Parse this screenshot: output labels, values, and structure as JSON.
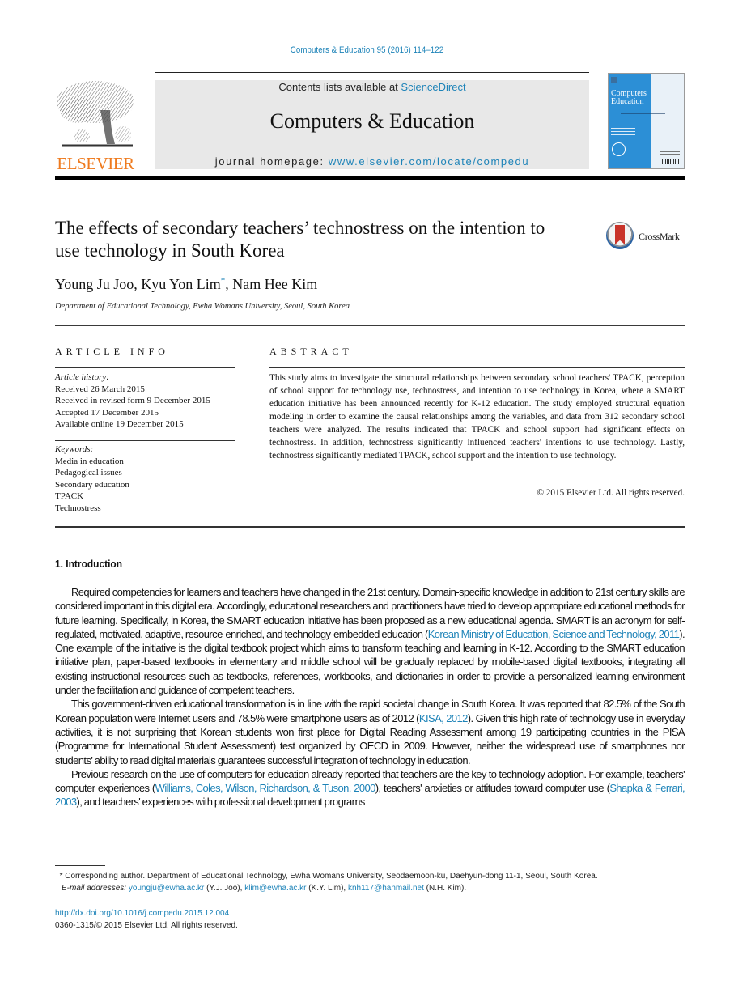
{
  "header": {
    "citation": "Computers & Education 95 (2016) 114–122",
    "publisher_logo_text": "ELSEVIER",
    "contents_prefix": "Contents lists available at ",
    "contents_link": "ScienceDirect",
    "journal_name": "Computers & Education",
    "homepage_prefix": "journal homepage: ",
    "homepage_link": "www.elsevier.com/locate/compedu",
    "cover_title_line1": "Computers",
    "cover_title_line2": "Education"
  },
  "article": {
    "title": "The effects of secondary teachers’ technostress on the intention to use technology in South Korea",
    "crossmark_label": "CrossMark",
    "authors": {
      "a1": "Young Ju Joo, ",
      "a2": "Kyu Yon Lim",
      "a2_mark": "*",
      "a3": ", Nam Hee Kim"
    },
    "affiliation": "Department of Educational Technology, Ewha Womans University, Seoul, South Korea"
  },
  "article_info": {
    "heading": "ARTICLE INFO",
    "history_label": "Article history:",
    "history": [
      "Received 26 March 2015",
      "Received in revised form 9 December 2015",
      "Accepted 17 December 2015",
      "Available online 19 December 2015"
    ],
    "keywords_label": "Keywords:",
    "keywords": [
      "Media in education",
      "Pedagogical issues",
      "Secondary education",
      "TPACK",
      "Technostress"
    ]
  },
  "abstract": {
    "heading": "ABSTRACT",
    "text": "This study aims to investigate the structural relationships between secondary school teachers' TPACK, perception of school support for technology use, technostress, and intention to use technology in Korea, where a SMART education initiative has been announced recently for K-12 education. The study employed structural equation modeling in order to examine the causal relationships among the variables, and data from 312 secondary school teachers were analyzed. The results indicated that TPACK and school support had significant effects on technostress. In addition, technostress significantly influenced teachers' intentions to use technology. Lastly, technostress significantly mediated TPACK, school support and the intention to use technology.",
    "copyright": "© 2015 Elsevier Ltd. All rights reserved."
  },
  "introduction": {
    "heading": "1.  Introduction",
    "p1_a": "Required competencies for learners and teachers have changed in the 21st century. Domain-specific knowledge in addition to 21st century skills are considered important in this digital era. Accordingly, educational researchers and practitioners have tried to develop appropriate educational methods for future learning. Specifically, in Korea, the SMART education initiative has been proposed as a new educational agenda. SMART is an acronym for self-regulated, motivated, adaptive, resource-enriched, and technology-embedded education (",
    "p1_ref": "Korean Ministry of Education, Science and Technology, 2011",
    "p1_b": "). One example of the initiative is the digital textbook project which aims to transform teaching and learning in K-12. According to the SMART education initiative plan, paper-based textbooks in elementary and middle school will be gradually replaced by mobile-based digital textbooks, integrating all existing instructional resources such as textbooks, references, workbooks, and dictionaries in order to provide a personalized learning environment under the facilitation and guidance of competent teachers.",
    "p2_a": "This government-driven educational transformation is in line with the rapid societal change in South Korea. It was reported that 82.5% of the South Korean population were Internet users and 78.5% were smartphone users as of 2012 (",
    "p2_ref": "KISA, 2012",
    "p2_b": "). Given this high rate of technology use in everyday activities, it is not surprising that Korean students won first place for Digital Reading Assessment among 19 participating countries in the PISA (Programme for International Student Assessment) test organized by OECD in 2009. However, neither the widespread use of smartphones nor students' ability to read digital materials guarantees successful integration of technology in education.",
    "p3_a": "Previous research on the use of computers for education already reported that teachers are the key to technology adoption. For example, teachers' computer experiences (",
    "p3_ref1": "Williams, Coles, Wilson, Richardson, & Tuson, 2000",
    "p3_b": "), teachers' anxieties or attitudes toward computer use (",
    "p3_ref2": "Shapka & Ferrari, 2003",
    "p3_c": "), and teachers' experiences with professional development programs"
  },
  "footnote": {
    "mark": "*",
    "corresponding": " Corresponding author. Department of Educational Technology, Ewha Womans University, Seodaemoon-ku, Daehyun-dong 11-1, Seoul, South Korea.",
    "email_label": "E-mail addresses:",
    "email1": "youngju@ewha.ac.kr",
    "email1_who": " (Y.J. Joo), ",
    "email2": "klim@ewha.ac.kr",
    "email2_who": " (K.Y. Lim), ",
    "email3": "knh117@hanmail.net",
    "email3_who": " (N.H. Kim).",
    "doi": "http://dx.doi.org/10.1016/j.compedu.2015.12.004",
    "issn": "0360-1315/© 2015 Elsevier Ltd. All rights reserved."
  }
}
